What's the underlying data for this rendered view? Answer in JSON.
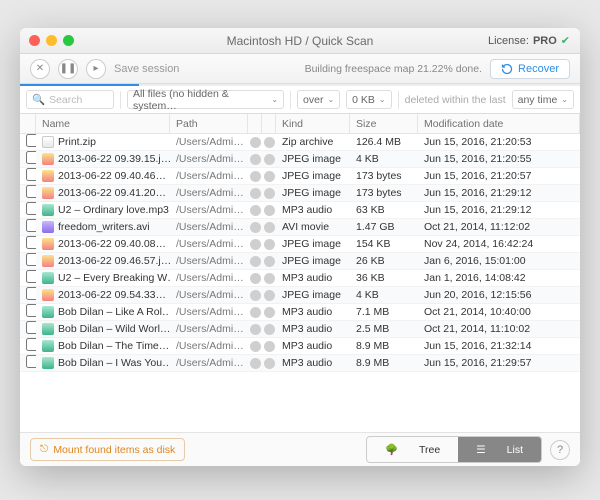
{
  "window": {
    "title": "Macintosh HD / Quick Scan"
  },
  "license": {
    "label": "License:",
    "tier": "PRO"
  },
  "toolbar": {
    "save_label": "Save session",
    "status": "Building freespace map 21.22% done.",
    "recover_label": "Recover"
  },
  "search": {
    "placeholder": "Search"
  },
  "filters": {
    "files_mode": "All files (no hidden & system…",
    "over_label": "over",
    "size_min": "0 KB",
    "deleted_label": "deleted within the last",
    "time_range": "any time"
  },
  "columns": {
    "name": "Name",
    "path": "Path",
    "kind": "Kind",
    "size": "Size",
    "mod": "Modification date"
  },
  "rows": [
    {
      "icon": "zip",
      "name": "Print.zip",
      "path": "/Users/Admin/D…",
      "kind": "Zip archive",
      "size": "126.4 MB",
      "mod": "Jun 15, 2016, 21:20:53"
    },
    {
      "icon": "img",
      "name": "2013-06-22 09.39.15.j…",
      "path": "/Users/Admin/P…",
      "kind": "JPEG image",
      "size": "4 KB",
      "mod": "Jun 15, 2016, 21:20:55"
    },
    {
      "icon": "img",
      "name": "2013-06-22 09.40.46…",
      "path": "/Users/Admin/P…",
      "kind": "JPEG image",
      "size": "173 bytes",
      "mod": "Jun 15, 2016, 21:20:57"
    },
    {
      "icon": "img",
      "name": "2013-06-22 09.41.20…",
      "path": "/Users/Admin/P…",
      "kind": "JPEG image",
      "size": "173 bytes",
      "mod": "Jun 15, 2016, 21:29:12"
    },
    {
      "icon": "aud",
      "name": "U2 – Ordinary love.mp3",
      "path": "/Users/Admin/M…",
      "kind": "MP3 audio",
      "size": "63 KB",
      "mod": "Jun 15, 2016, 21:29:12"
    },
    {
      "icon": "vid",
      "name": "freedom_writers.avi",
      "path": "/Users/Admin/…",
      "kind": "AVI movie",
      "size": "1.47 GB",
      "mod": "Oct 21, 2014, 11:12:02"
    },
    {
      "icon": "img",
      "name": "2013-06-22 09.40.08…",
      "path": "/Users/Admin/P…",
      "kind": "JPEG image",
      "size": "154 KB",
      "mod": "Nov 24, 2014, 16:42:24"
    },
    {
      "icon": "img",
      "name": "2013-06-22 09.46.57.j…",
      "path": "/Users/Admin/P…",
      "kind": "JPEG image",
      "size": "26 KB",
      "mod": "Jan 6, 2016, 15:01:00"
    },
    {
      "icon": "aud",
      "name": "U2 – Every Breaking W…",
      "path": "/Users/Admin/M…",
      "kind": "MP3 audio",
      "size": "36 KB",
      "mod": "Jan 1, 2016, 14:08:42"
    },
    {
      "icon": "img",
      "name": "2013-06-22 09.54.33…",
      "path": "/Users/Admin/P…",
      "kind": "JPEG image",
      "size": "4 KB",
      "mod": "Jun 20, 2016, 12:15:56"
    },
    {
      "icon": "aud",
      "name": "Bob Dilan – Like A Rol…",
      "path": "/Users/Admin/M…",
      "kind": "MP3 audio",
      "size": "7.1 MB",
      "mod": "Oct 21, 2014, 10:40:00"
    },
    {
      "icon": "aud",
      "name": "Bob Dilan – Wild Worl…",
      "path": "/Users/Admin/M…",
      "kind": "MP3 audio",
      "size": "2.5 MB",
      "mod": "Oct 21, 2014, 11:10:02"
    },
    {
      "icon": "aud",
      "name": "Bob Dilan – The Time…",
      "path": "/Users/Admin/M…",
      "kind": "MP3 audio",
      "size": "8.9 MB",
      "mod": "Jun 15, 2016, 21:32:14"
    },
    {
      "icon": "aud",
      "name": "Bob Dilan – I Was You…",
      "path": "/Users/Admin/M…",
      "kind": "MP3 audio",
      "size": "8.9 MB",
      "mod": "Jun 15, 2016, 21:29:57"
    }
  ],
  "footer": {
    "mount_label": "Mount found items as disk",
    "tree_label": "Tree",
    "list_label": "List"
  }
}
